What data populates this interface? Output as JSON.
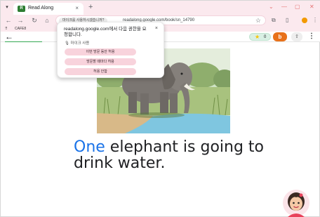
{
  "browser": {
    "tab_title": "Read Along",
    "tab_favicon_text": "R",
    "tab_close": "×",
    "new_tab": "+",
    "window_controls": [
      "⌄",
      "—",
      "▢",
      "✕"
    ],
    "tab_menu": "▾"
  },
  "toolbar": {
    "back": "←",
    "forward": "→",
    "reload": "↻",
    "home": "⌂",
    "permission_chip": "마이크를 사용하시겠습니까?",
    "url": "readalong.google.com/book/sn_14790",
    "bookmark_star": "☆",
    "extensions_icon": "⧉",
    "sidepanel_icon": "▯"
  },
  "bookmarks": {
    "apps_icon": "⠿",
    "items": [
      "CAFE8"
    ]
  },
  "app": {
    "back_arrow": "←",
    "stars_count": "0",
    "star_icon": "★",
    "avatar_letter": "b",
    "upload_icon": "⇧",
    "more_icon": "⋮",
    "reading_progress": 0.12
  },
  "colors": {
    "accent_blue": "#1a73e8",
    "avatar_orange": "#e8711a",
    "progress_green": "#34a853",
    "chrome_pink": "#fbe9ee",
    "popup_button_pink": "#f8d3dc"
  },
  "story": {
    "highlighted_word": "One",
    "text_rest": " elephant is going to drink water."
  },
  "permission_popup": {
    "title": "readalong.google.com에서 다음 권한을 요청합니다.",
    "close": "×",
    "mic_icon": "🎙",
    "mic_label": "마이크 사용",
    "buttons": [
      "이번 방문 동안 허용",
      "방문할 때마다 허용",
      "허용 안함"
    ]
  }
}
